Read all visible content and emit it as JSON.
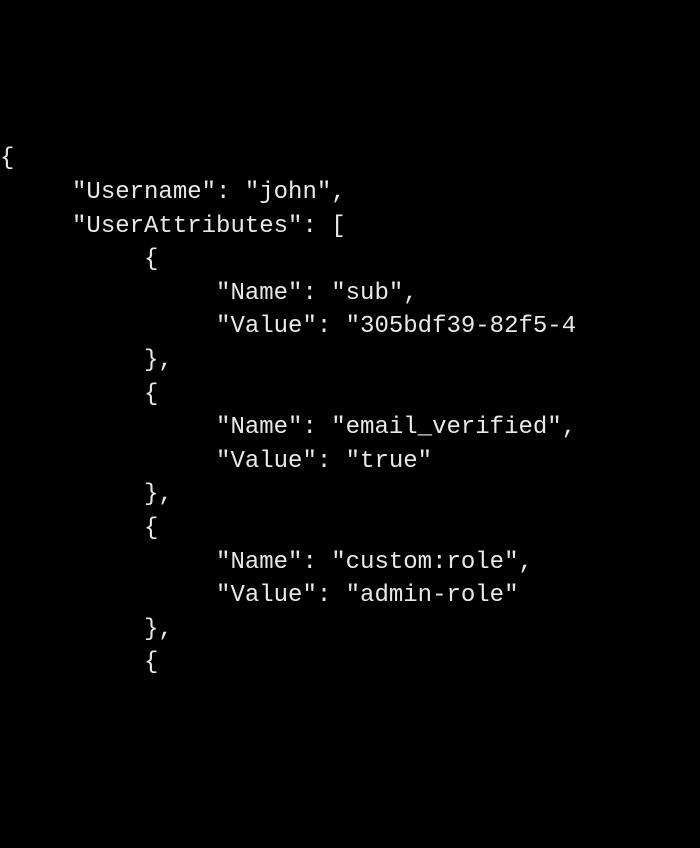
{
  "lines": {
    "l0": "{",
    "l1": "     \"Username\": \"john\",",
    "l2": "     \"UserAttributes\": [",
    "l3": "          {",
    "l4": "               \"Name\": \"sub\",",
    "l5": "               \"Value\": \"305bdf39-82f5-4",
    "l6": "          },",
    "l7": "          {",
    "l8": "               \"Name\": \"email_verified\",",
    "l9": "               \"Value\": \"true\"",
    "l10": "          },",
    "l11": "          {",
    "l12": "               \"Name\": \"custom:role\",",
    "l13": "               \"Value\": \"admin-role\"",
    "l14": "          },",
    "l15": "          {"
  }
}
